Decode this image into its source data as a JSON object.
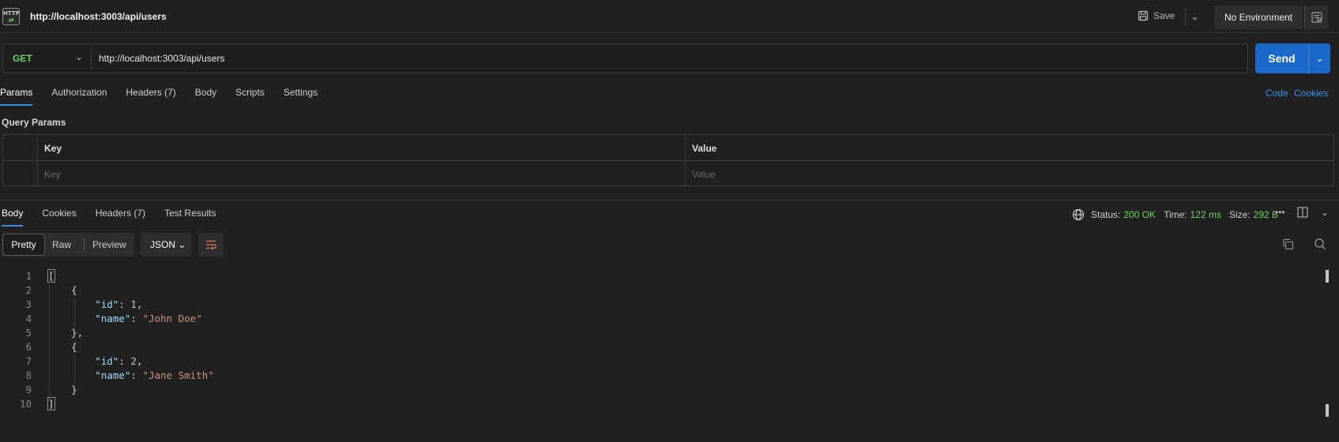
{
  "top_bar": {
    "tab_title": "http://localhost:3003/api/users",
    "save_label": "Save",
    "environment": "No Environment"
  },
  "request": {
    "method": "GET",
    "url": "http://localhost:3003/api/users",
    "send_label": "Send",
    "tabs": [
      {
        "label": "Params"
      },
      {
        "label": "Authorization"
      },
      {
        "label": "Headers",
        "count": "(7)"
      },
      {
        "label": "Body"
      },
      {
        "label": "Scripts"
      },
      {
        "label": "Settings"
      }
    ],
    "code_link": "Code",
    "cookies_link": "Cookies"
  },
  "query_params": {
    "title": "Query Params",
    "key_header": "Key",
    "value_header": "Value",
    "key_placeholder": "Key",
    "value_placeholder": "Value"
  },
  "response": {
    "tabs": [
      {
        "label": "Body"
      },
      {
        "label": "Cookies"
      },
      {
        "label": "Headers",
        "count": "(7)"
      },
      {
        "label": "Test Results"
      }
    ],
    "status_label": "Status:",
    "status_value": "200 OK",
    "time_label": "Time:",
    "time_value": "122 ms",
    "size_label": "Size:",
    "size_value": "292 B",
    "more": "•••",
    "format_options": [
      "Pretty",
      "Raw",
      "Preview"
    ],
    "language": "JSON",
    "code_lines": [
      {
        "n": "1",
        "text": "["
      },
      {
        "n": "2",
        "text": "    {"
      },
      {
        "n": "3",
        "key": "\"id\"",
        "sep": ": ",
        "num": "1",
        "tail": ","
      },
      {
        "n": "4",
        "key": "\"name\"",
        "sep": ": ",
        "str": "\"John Doe\"",
        "tail": ""
      },
      {
        "n": "5",
        "text": "    },"
      },
      {
        "n": "6",
        "text": "    {"
      },
      {
        "n": "7",
        "key": "\"id\"",
        "sep": ": ",
        "num": "2",
        "tail": ","
      },
      {
        "n": "8",
        "key": "\"name\"",
        "sep": ": ",
        "str": "\"Jane Smith\"",
        "tail": ""
      },
      {
        "n": "9",
        "text": "    }"
      },
      {
        "n": "10",
        "text": "]"
      }
    ]
  },
  "colors": {
    "accent": "#3b8eea",
    "success": "#6bd65c",
    "send": "#1b6ac9",
    "json_key": "#9cdcfe",
    "json_string": "#ce9178",
    "json_number": "#b5cea8"
  }
}
